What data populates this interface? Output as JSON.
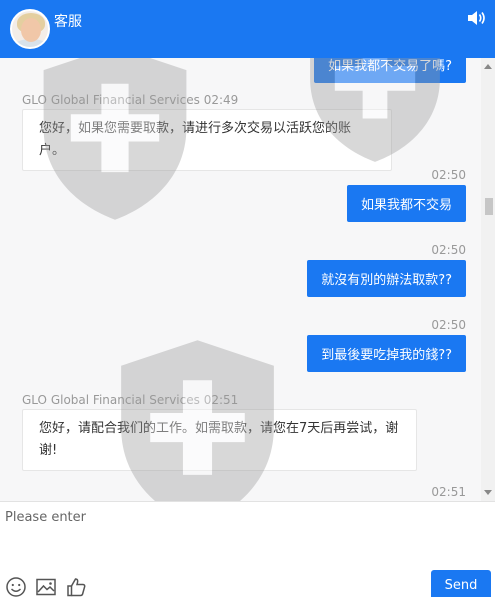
{
  "header": {
    "title": "客服",
    "avatar_icon": "agent-avatar",
    "volume_icon": "speaker-icon"
  },
  "messages": [
    {
      "type": "out",
      "text": "如果我都不交易了嗎?",
      "time": ""
    },
    {
      "type": "in",
      "sender": "GLO Global Financial Services 02:49",
      "text": "您好，如果您需要取款，请进行多次交易以活跃您的账户。"
    },
    {
      "type": "out",
      "time": "02:50",
      "text": "如果我都不交易"
    },
    {
      "type": "out",
      "time": "02:50",
      "text": "就沒有別的辦法取款??"
    },
    {
      "type": "out",
      "time": "02:50",
      "text": "到最後要吃掉我的錢??"
    },
    {
      "type": "in",
      "sender": "GLO Global Financial Services 02:51",
      "text": "您好，请配合我们的工作。如需取款，请您在7天后再尝试，谢谢!"
    },
    {
      "type": "out",
      "time": "02:51",
      "text": ""
    }
  ],
  "composer": {
    "placeholder": "Please enter",
    "value": "",
    "send_label": "Send"
  },
  "toolbar": {
    "icons": [
      "emoji-icon",
      "image-icon",
      "thumbs-up-icon"
    ]
  },
  "colors": {
    "accent": "#1a78f2",
    "chat_bg": "#f7f7f8",
    "meta_text": "#999999"
  }
}
